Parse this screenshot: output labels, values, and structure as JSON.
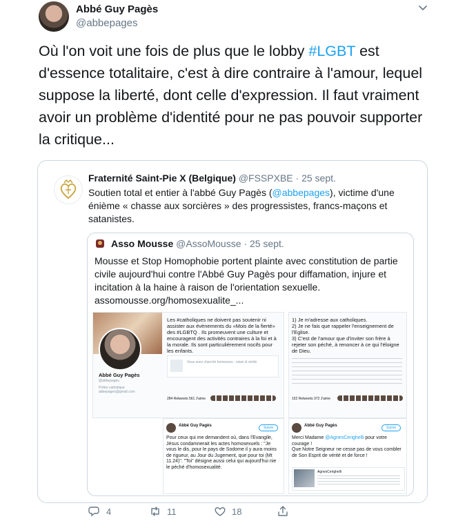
{
  "tweet": {
    "author_name": "Abbé Guy Pagès",
    "author_handle": "@abbepages",
    "text_before": "Où l'on voit une fois de plus que le lobby ",
    "hashtag": "#LGBT",
    "text_after": " est d'essence totalitaire, c'est à dire contraire à l'amour, lequel suppose la liberté, dont celle d'expression. Il faut vraiment avoir un problème d'identité pour ne pas pouvoir supporter la critique..."
  },
  "quote": {
    "author_name": "Fraternité Saint-Pie X (Belgique)",
    "author_handle": "@FSSPXBE",
    "date": "· 25 sept.",
    "text_before": "Soutien total et entier à l'abbé Guy Pagès (",
    "mention": "@abbepages",
    "text_after": "), victime d'une énième « chasse aux sorcières » des progressistes, francs-maçons et satanistes."
  },
  "inner": {
    "author_name": "Asso Mousse",
    "author_handle": "@AssoMousse",
    "date": "· 25 sept.",
    "text": "Mousse et Stop Homophobie portent plainte avec constitution de partie civile aujourd'hui contre l'Abbé Guy Pagès pour diffamation, injure et incitation à la haine à raison de l'orientation sexuelle.",
    "link": "assomousse.org/homosexualite_..."
  },
  "screenshots": {
    "profile_name": "Abbé Guy Pagès",
    "profile_handle": "@abbepages",
    "profile_bio": "Prêtre catholique abbepages@gmail.com",
    "s1_text": "Les #catholiques ne doivent pas soutenir ni assister aux évènements du «Mois de la fierté» des #LGBTQ . Ils promeuvent une culture et encouragent des activités contraires à la foi et à la morale. Ils sont particulièrement nocifs pour les enfants.",
    "s1_card": "Vous avez cherché homosexu - islam & vérité",
    "s1_stats": "284 Retweets  561 J'aime",
    "s2_text": "1) Je m'adresse aux catholiques.\n2) Je ne fais que rappeler l'enseignement de l'Eglise.\n3) C'est de l'amour que d'inviter son frère à rejeter son péché, à renoncer à ce qui l'éloigne de Dieu.",
    "s2_stats": "152 Retweets  372 J'aime",
    "s3_name": "Abbé Guy Pagès",
    "s3_button": "Suivre",
    "s3_text": "Pour ceux qui me demandent où, dans l'Evangile, Jésus condamnerait les actes homosexuels : \"Je vous le dis, pour le pays de Sodome il y aura moins de rigueur, au Jour du Jugement, que pour toi (Mt 11.24)\". \"Toi\" désigne aussi celui qui aujourd'hui nie le péché d'homosexualité.",
    "s4_name": "Abbé Guy Pagès",
    "s4_button": "Suivre",
    "s4_text_a": "Merci Madame ",
    "s4_mention": "@AgnesCerighelli",
    "s4_text_b": " pour votre courage !\nQue Notre Seigneur ne cesse pas de vous combler de Son Esprit de vérité et de force !",
    "s4_reply_name": "AgnesCerighelli"
  },
  "actions": {
    "replies": "4",
    "retweets": "11",
    "likes": "18"
  },
  "colors": {
    "accent": "#1da1f2",
    "secondary_text": "#657786",
    "border": "#ccd6dd"
  }
}
